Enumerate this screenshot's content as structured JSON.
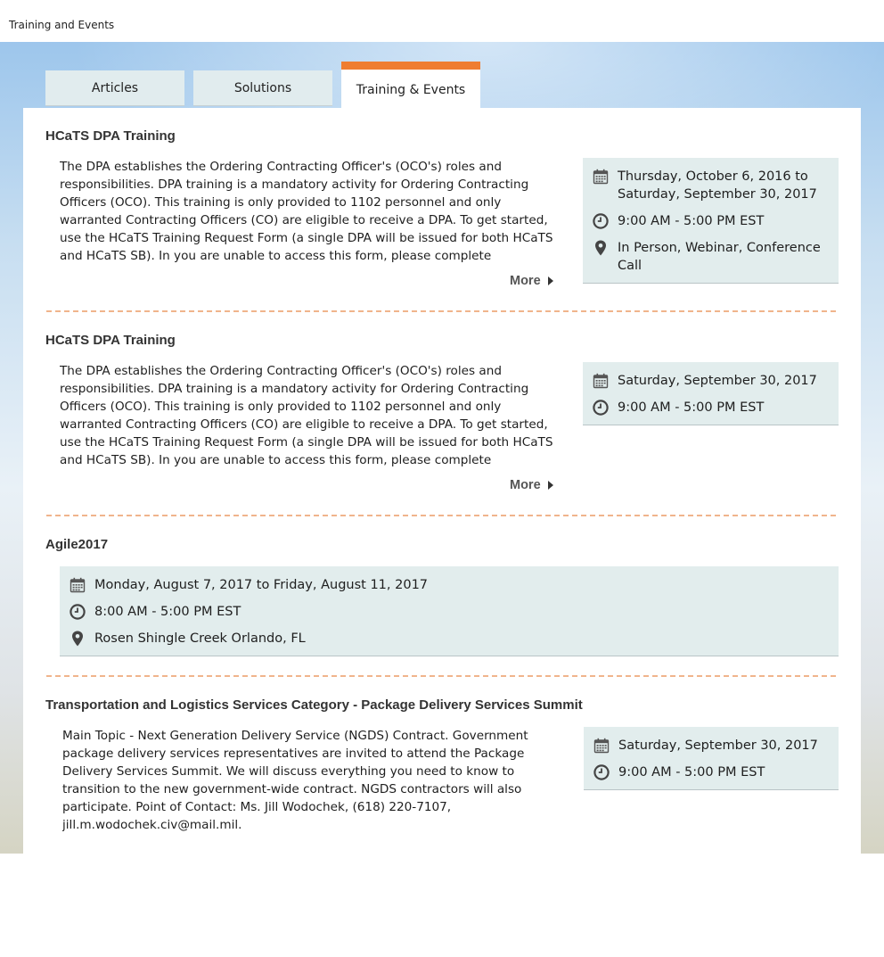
{
  "page": {
    "title": "Training and Events"
  },
  "tabs": [
    {
      "label": "Articles",
      "active": false
    },
    {
      "label": "Solutions",
      "active": false
    },
    {
      "label": "Training & Events",
      "active": true
    }
  ],
  "colors": {
    "accent_orange": "#ef7d31",
    "info_panel_bg": "#e2eded",
    "divider": "#f0b48c"
  },
  "events": [
    {
      "title": "HCaTS DPA Training",
      "description": "The DPA establishes the Ordering Contracting Officer's (OCO's) roles and responsibilities. DPA training is a mandatory activity for Ordering Contracting Officers (OCO). This training is only provided to 1102 personnel and only warranted Contracting Officers (CO) are eligible to receive a DPA. To get started, use the HCaTS Training Request Form (a single DPA will be issued for both HCaTS and HCaTS SB). In you are unable to access this form, please complete",
      "more_label": "More",
      "date": "Thursday, October 6, 2016 to Saturday, September 30, 2017",
      "time": "9:00 AM - 5:00 PM EST",
      "location": "In Person, Webinar, Conference Call"
    },
    {
      "title": "HCaTS DPA Training",
      "description": "The DPA establishes the Ordering Contracting Officer's (OCO's) roles and responsibilities. DPA training is a mandatory activity for Ordering Contracting Officers (OCO). This training is only provided to 1102 personnel and only warranted Contracting Officers (CO) are eligible to receive a DPA. To get started, use the HCaTS Training Request Form (a single DPA will be issued for both HCaTS and HCaTS SB). In you are unable to access this form, please complete",
      "more_label": "More",
      "date": "Saturday, September 30, 2017",
      "time": "9:00 AM - 5:00 PM EST"
    },
    {
      "title": "Agile2017",
      "date": "Monday, August 7, 2017 to Friday, August 11, 2017",
      "time": "8:00 AM - 5:00 PM EST",
      "location": "Rosen Shingle Creek Orlando, FL"
    },
    {
      "title": "Transportation and Logistics Services Category - Package Delivery Services Summit",
      "description": "Main Topic - Next Generation Delivery Service (NGDS) Contract.   Government package delivery services representatives are invited to attend the Package Delivery Services Summit. We will discuss everything you need to know to transition to the new government-wide contract. NGDS contractors will also participate.   Point of Contact:  Ms. Jill Wodochek, (618) 220-7107, jill.m.wodochek.civ@mail.mil.",
      "date": "Saturday, September 30, 2017",
      "time": "9:00 AM - 5:00 PM EST"
    }
  ]
}
